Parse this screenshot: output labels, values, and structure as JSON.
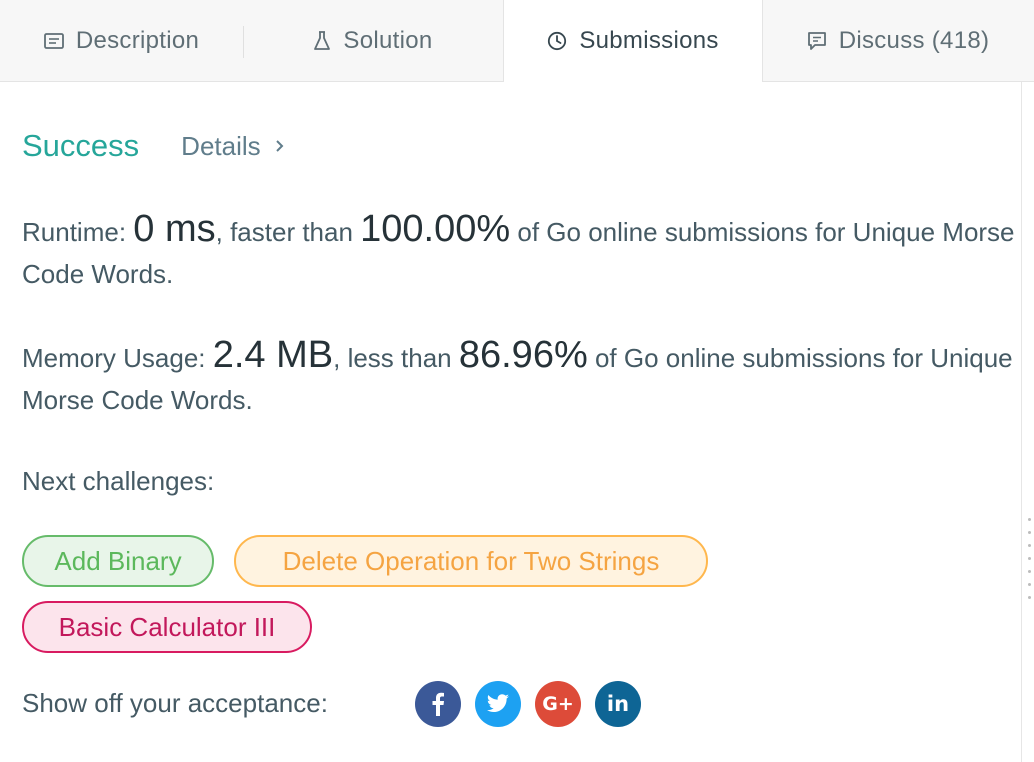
{
  "tabs": {
    "description": "Description",
    "solution": "Solution",
    "submissions": "Submissions",
    "discuss": "Discuss (418)"
  },
  "result": {
    "status": "Success",
    "details": "Details"
  },
  "runtime": {
    "label": "Runtime: ",
    "value": "0 ms",
    "mid": ", faster than ",
    "percent": "100.00%",
    "suffix": " of Go online submissions for Unique Morse Code Words."
  },
  "memory": {
    "label": "Memory Usage: ",
    "value": "2.4 MB",
    "mid": ", less than ",
    "percent": "86.96%",
    "suffix": " of Go online submissions for Unique Morse Code Words."
  },
  "next_challenges": {
    "label": "Next challenges:",
    "items": [
      "Add Binary",
      "Delete Operation for Two Strings",
      "Basic Calculator III"
    ]
  },
  "share": {
    "label": "Show off your acceptance:",
    "icons": [
      "facebook-icon",
      "twitter-icon",
      "google-plus-icon",
      "linkedin-icon"
    ]
  },
  "colors": {
    "success": "#26a69a",
    "easy": "#5cb85c",
    "medium": "#f5a442",
    "hard": "#c2185b"
  }
}
